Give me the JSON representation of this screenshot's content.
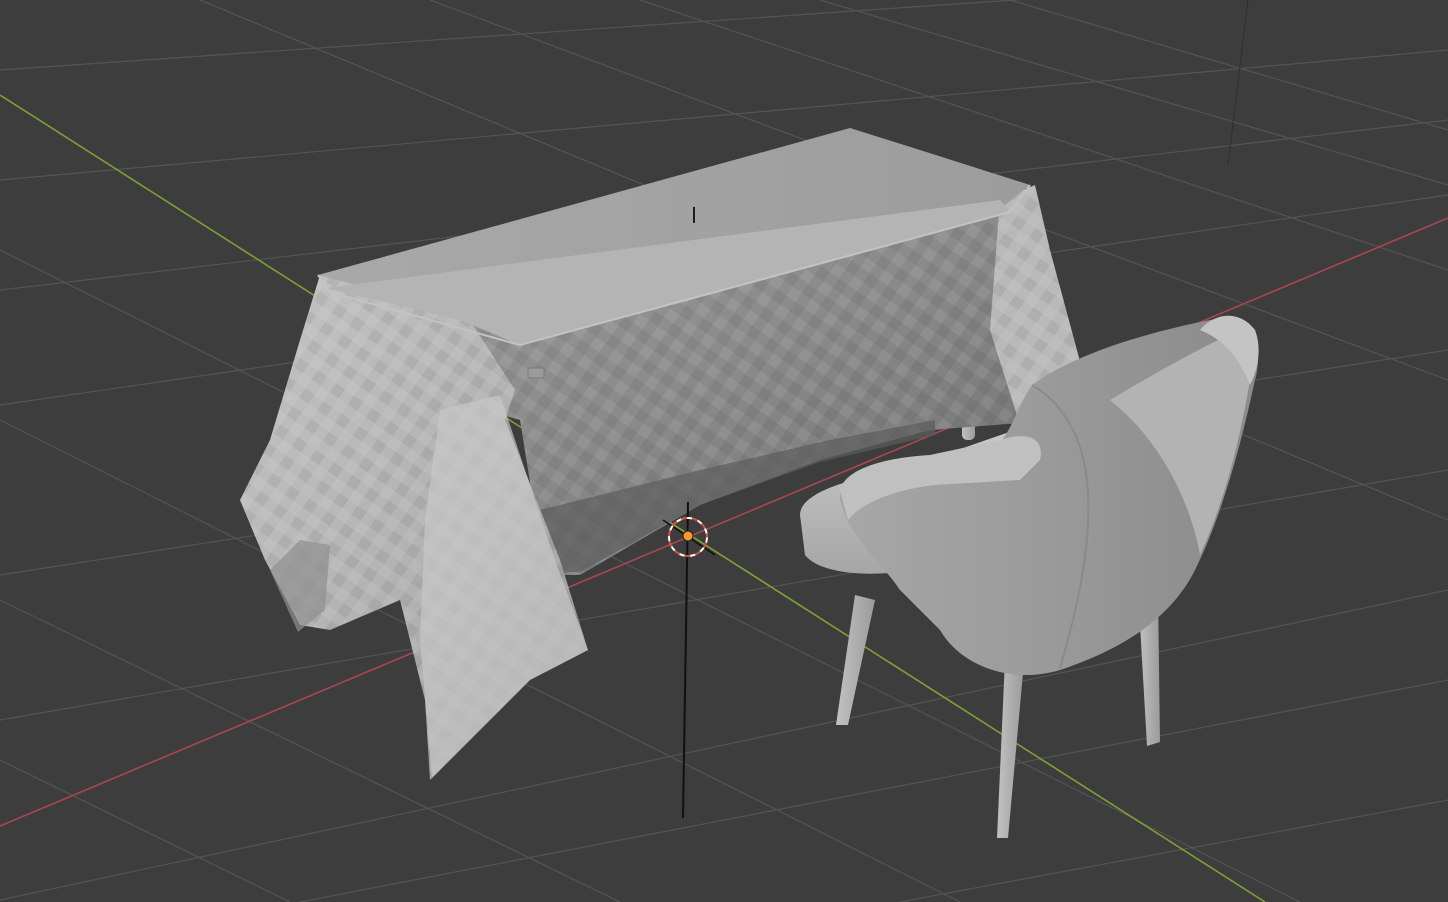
{
  "viewport": {
    "name": "3D Viewport",
    "shading": "solid",
    "background_color": "#3d3d3d",
    "grid_line_color": "#545454",
    "x_axis_color": "#a7474e",
    "y_axis_color": "#7ea033",
    "object_color": "#a3a3a3"
  },
  "objects": [
    {
      "name": "tablecloth",
      "type": "cloth mesh"
    },
    {
      "name": "table",
      "type": "mesh"
    },
    {
      "name": "armchair",
      "type": "mesh"
    }
  ],
  "gizmos": {
    "origin_color": "#f59a2b",
    "cursor_ring_colors": [
      "#d7523e",
      "#ffffff"
    ]
  }
}
